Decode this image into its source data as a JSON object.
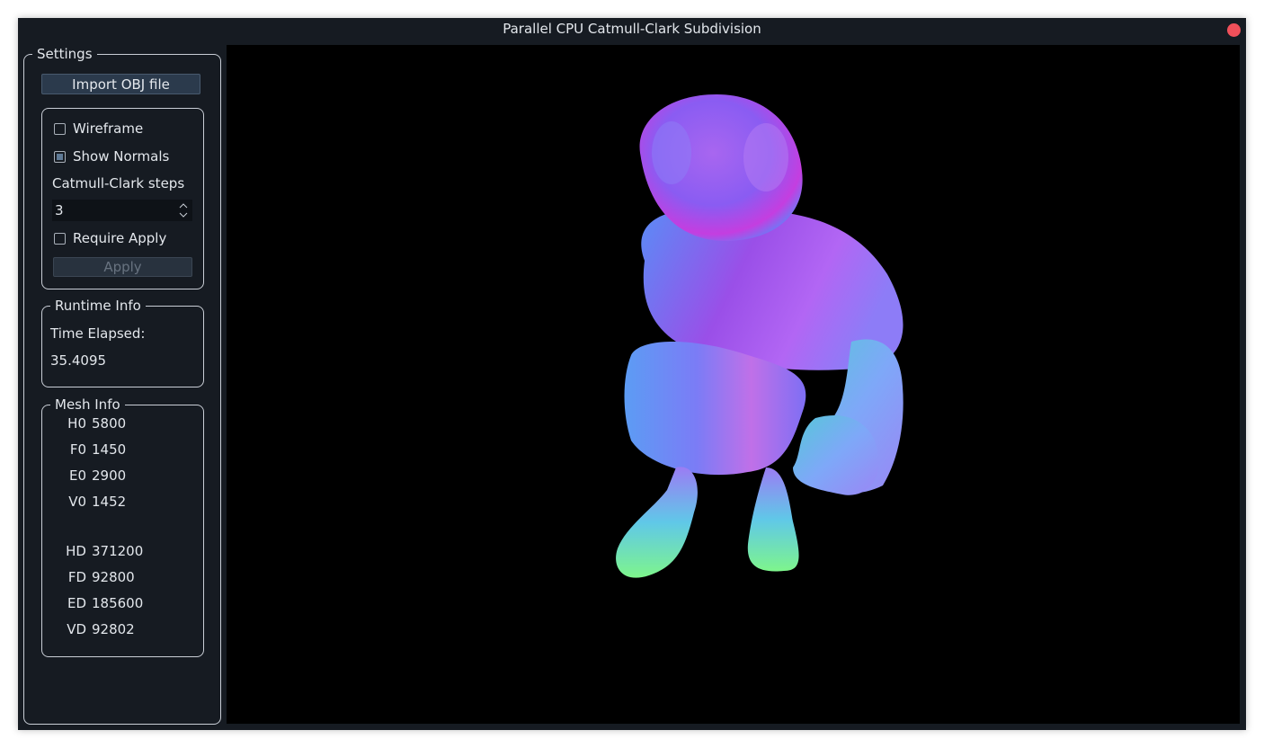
{
  "window": {
    "title": "Parallel CPU Catmull-Clark Subdivision",
    "close_icon": "close-circle-icon",
    "close_color": "#f0505a"
  },
  "settings": {
    "group_title": "Settings",
    "import_button": "Import OBJ file",
    "wireframe": {
      "label": "Wireframe",
      "checked": false
    },
    "show_normals": {
      "label": "Show Normals",
      "checked": true
    },
    "steps_label": "Catmull-Clark steps",
    "steps_value": "3",
    "require_apply": {
      "label": "Require Apply",
      "checked": false
    },
    "apply_button": "Apply",
    "apply_enabled": false
  },
  "runtime": {
    "group_title": "Runtime Info",
    "time_label": "Time Elapsed:",
    "time_value": "35.4095"
  },
  "mesh": {
    "group_title": "Mesh Info",
    "base": [
      {
        "key": "H0",
        "value": "5800"
      },
      {
        "key": "F0",
        "value": "1450"
      },
      {
        "key": "E0",
        "value": "2900"
      },
      {
        "key": "V0",
        "value": "1452"
      }
    ],
    "subdivided": [
      {
        "key": "HD",
        "value": "371200"
      },
      {
        "key": "FD",
        "value": "92800"
      },
      {
        "key": "ED",
        "value": "185600"
      },
      {
        "key": "VD",
        "value": "92802"
      }
    ]
  },
  "viewport": {
    "content": "normal-shaded subdivided character mesh",
    "background": "#000000"
  }
}
